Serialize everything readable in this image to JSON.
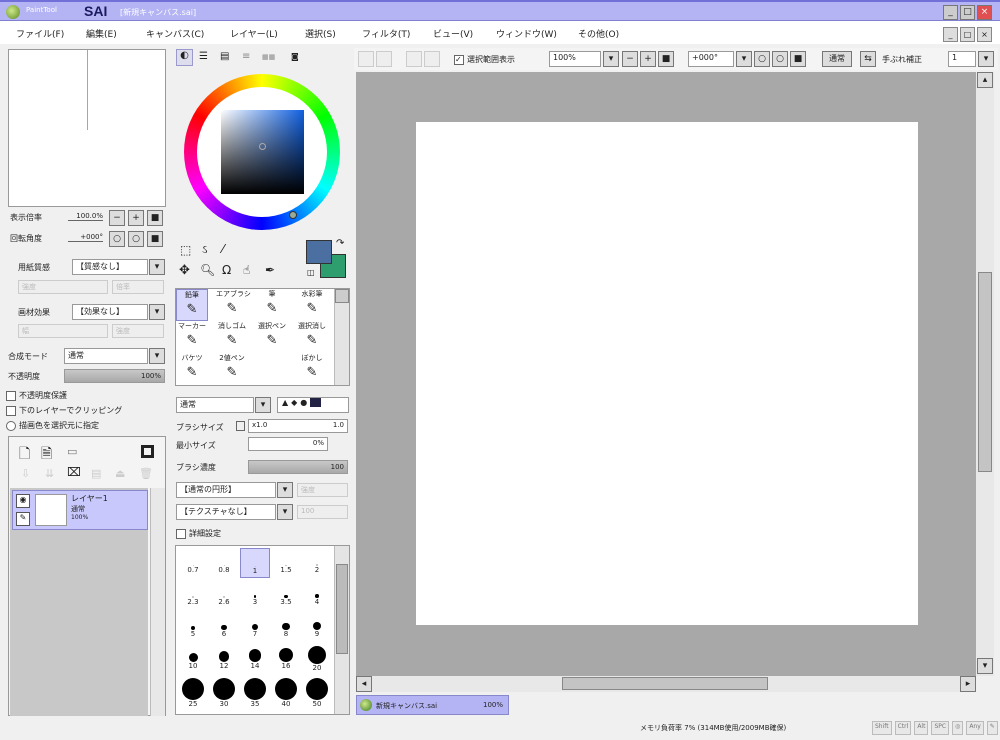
{
  "window": {
    "app_name": "PaintTool",
    "logo": "SAI",
    "document_title": "[新規キャンバス.sai]",
    "controls": [
      "_",
      "□",
      "×"
    ]
  },
  "menu": [
    "ファイル(F)",
    "編集(E)",
    "キャンバス(C)",
    "レイヤー(L)",
    "選択(S)",
    "フィルタ(T)",
    "ビュー(V)",
    "ウィンドウ(W)",
    "その他(O)"
  ],
  "mdi_controls": [
    "_",
    "□",
    "×"
  ],
  "navigator": {
    "zoom_label": "表示倍率",
    "zoom_value": "100.0%",
    "rotate_label": "回転角度",
    "rotate_value": "+000°",
    "zoom_buttons": [
      "−",
      "+",
      "■"
    ],
    "rotate_buttons": [
      "○",
      "○",
      "■"
    ]
  },
  "layer_props": {
    "texture_label": "用紙質感",
    "texture_value": "【質感なし】",
    "texture_sub": [
      "強度",
      "100",
      "倍率",
      "1"
    ],
    "effect_label": "画材効果",
    "effect_value": "【効果なし】",
    "effect_sub": [
      "幅",
      "強度"
    ],
    "blend_label": "合成モード",
    "blend_value": "通常",
    "opacity_label": "不透明度",
    "opacity_value": "100%",
    "opacity": 1.0,
    "checks": [
      "不透明度保護",
      "下のレイヤーでクリッピング",
      "描画色を選択元に指定"
    ]
  },
  "layers": [
    {
      "name": "レイヤー1",
      "mode": "通常",
      "opacity": "100%"
    }
  ],
  "color_tabs": [
    "wheel",
    "rgb",
    "hsv",
    "slider",
    "swatch",
    "scratch"
  ],
  "colors": {
    "primary": "#4a6fa0",
    "secondary": "#2e9e6e",
    "accent": "#b4b4f4"
  },
  "tools": [
    {
      "label": "鉛筆",
      "icon": "pencil-icon",
      "selected": true
    },
    {
      "label": "エアブラシ",
      "icon": "airbrush-icon"
    },
    {
      "label": "筆",
      "icon": "brush-icon"
    },
    {
      "label": "水彩筆",
      "icon": "watercolor-icon"
    },
    {
      "label": "マーカー",
      "icon": "marker-icon"
    },
    {
      "label": "消しゴム",
      "icon": "eraser-icon"
    },
    {
      "label": "選択ペン",
      "icon": "select-pen-icon"
    },
    {
      "label": "選択消し",
      "icon": "select-eraser-icon"
    },
    {
      "label": "バケツ",
      "icon": "bucket-icon"
    },
    {
      "label": "2値ペン",
      "icon": "binary-pen-icon"
    },
    {
      "label": "",
      "icon": ""
    },
    {
      "label": "ぼかし",
      "icon": "blur-icon"
    }
  ],
  "brush": {
    "shape": "通常",
    "size_label": "ブラシサイズ",
    "size_mult": "x1.0",
    "size_value": "1.0",
    "min_label": "最小サイズ",
    "min_value": "0%",
    "density_label": "ブラシ濃度",
    "density_value": "100",
    "tip": "【通常の円形】",
    "texture": "【テクスチャなし】",
    "detail_label": "詳細設定",
    "sub": [
      "強度",
      "100"
    ]
  },
  "brush_sizes": [
    "0.7",
    "0.8",
    "1",
    "1.5",
    "2",
    "2.3",
    "2.6",
    "3",
    "3.5",
    "4",
    "5",
    "6",
    "7",
    "8",
    "9",
    "10",
    "12",
    "14",
    "16",
    "20",
    "25",
    "30",
    "35",
    "40",
    "50"
  ],
  "selected_size": "1",
  "canvas_toolbar": {
    "selection_label": "選択範囲表示",
    "zoom": "100%",
    "rotate": "+000°",
    "mode": "通常",
    "stabilizer_label": "手ぶれ補正",
    "stabilizer_value": "1"
  },
  "tab": {
    "name": "新規キャンバス.sai",
    "zoom": "100%"
  },
  "status": {
    "memory": "メモリ負荷率 7% (314MB使用/2009MB確保)",
    "indicators": [
      "Shift",
      "Ctrl",
      "Alt",
      "SPC",
      "◎",
      "Any",
      "✎"
    ]
  }
}
